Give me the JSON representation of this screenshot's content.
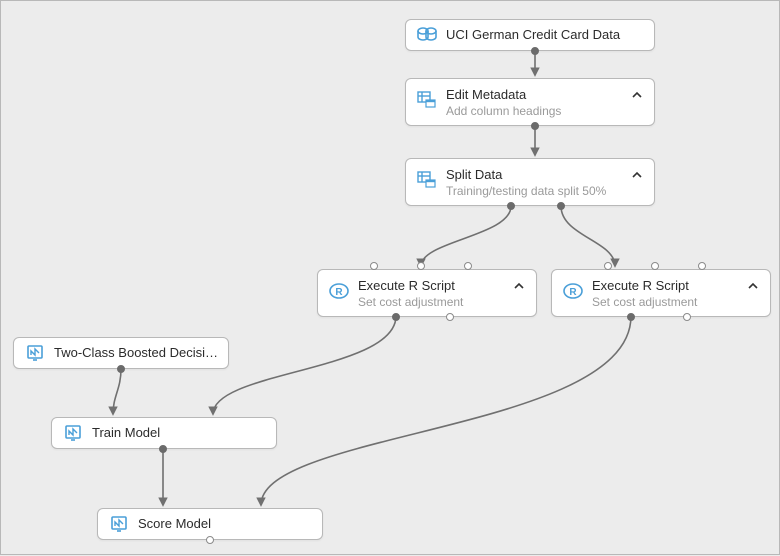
{
  "nodes": {
    "data_source": {
      "title": "UCI German Credit Card Data",
      "icon": "dataset-icon"
    },
    "edit_metadata": {
      "title": "Edit Metadata",
      "subtitle": "Add column headings",
      "icon": "table-edit-icon",
      "expandable": true
    },
    "split_data": {
      "title": "Split Data",
      "subtitle": "Training/testing data split 50%",
      "icon": "table-edit-icon",
      "expandable": true
    },
    "r_script_left": {
      "title": "Execute R Script",
      "subtitle": "Set cost adjustment",
      "icon": "r-script-icon",
      "expandable": true
    },
    "r_script_right": {
      "title": "Execute R Script",
      "subtitle": "Set cost adjustment",
      "icon": "r-script-icon",
      "expandable": true
    },
    "two_class": {
      "title": "Two-Class Boosted Decision...",
      "icon": "model-icon"
    },
    "train_model": {
      "title": "Train Model",
      "icon": "model-icon"
    },
    "score_model": {
      "title": "Score Model",
      "icon": "model-icon"
    }
  },
  "colors": {
    "icon_blue": "#4a9fd8",
    "connector": "#707070"
  }
}
